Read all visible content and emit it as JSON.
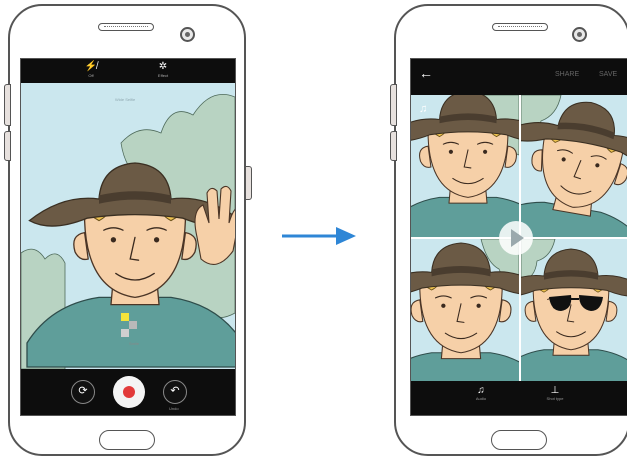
{
  "left_phone": {
    "top_bar": [
      {
        "label": "Off",
        "icon": "flash-off-icon"
      },
      {
        "label": "Effect",
        "icon": "effect-icon"
      }
    ],
    "viewfinder_hint": "Wide Selfie",
    "focus_label": "Smile",
    "bottom_bar": {
      "switch_camera_icon": "switch-camera-icon",
      "record_icon": "record-icon",
      "undo_icon": "undo-icon",
      "undo_label": "Undo"
    }
  },
  "arrow": {
    "color": "#2e86d6"
  },
  "right_phone": {
    "header": {
      "back_icon": "back-arrow-icon",
      "share_label": "SHARE",
      "save_label": "SAVE"
    },
    "music_icon": "music-note-icon",
    "play_icon": "play-icon",
    "bottom_bar": [
      {
        "label": "Audio",
        "icon": "music-note-icon"
      },
      {
        "label": "Shot type",
        "icon": "shot-type-icon"
      }
    ]
  },
  "colors": {
    "record": "#e23a3a",
    "shirt": "#5f9e9a",
    "sky": "#cbe7ee",
    "hat": "#6b5a45"
  }
}
